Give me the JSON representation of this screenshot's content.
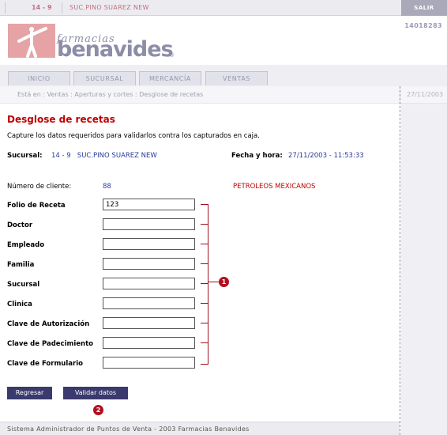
{
  "topbar": {
    "store_code": "14 - 9",
    "store_name": "SUC.PINO SUAREZ NEW",
    "exit_label": "SALIR"
  },
  "brand": {
    "logo_small": "farmacias",
    "logo_big": "benavides",
    "logo_reg": "®"
  },
  "user_id": "14018283",
  "nav": {
    "tabs": [
      {
        "label": "INICIO"
      },
      {
        "label": "SUCURSAL"
      },
      {
        "label": "MERCANCÍA"
      },
      {
        "label": "VENTAS"
      }
    ]
  },
  "breadcrumb": "Está en : Ventas : Aperturas y cortes : Desglose de recetas",
  "side_date": "27/11/2003",
  "page": {
    "title": "Desglose de recetas",
    "instructions": "Capture los datos requeridos para validarlos contra los capturados en caja.",
    "branch_label": "Sucursal:",
    "branch_value": "14 - 9   SUC.PINO SUAREZ NEW",
    "datetime_label": "Fecha y hora:",
    "datetime_value": "27/11/2003 - 11:53:33",
    "client_label": "Número de cliente:",
    "client_number": "88",
    "client_name": "PETROLEOS MEXICANOS"
  },
  "form": {
    "fields": [
      {
        "label": "Folio de Receta",
        "value": "123"
      },
      {
        "label": "Doctor",
        "value": ""
      },
      {
        "label": "Empleado",
        "value": ""
      },
      {
        "label": "Familia",
        "value": ""
      },
      {
        "label": "Sucursal",
        "value": ""
      },
      {
        "label": "Clinica",
        "value": ""
      },
      {
        "label": "Clave de Autorización",
        "value": ""
      },
      {
        "label": "Clave de Padecimiento",
        "value": ""
      },
      {
        "label": "Clave de Formulario",
        "value": ""
      }
    ],
    "back_button": "Regresar",
    "validate_button": "Validar datos"
  },
  "callouts": {
    "first": "1",
    "second": "2"
  },
  "footer": "Sistema Administrador de Puntos de Venta - 2003 Farmacias Benavides",
  "colors": {
    "accent_red": "#c00000",
    "value_blue": "#2a3a9a",
    "button_bg": "#3a3a6e",
    "callout_red": "#b01020",
    "logo_pink": "#e6a3a6",
    "logo_gray": "#8d8da8"
  }
}
